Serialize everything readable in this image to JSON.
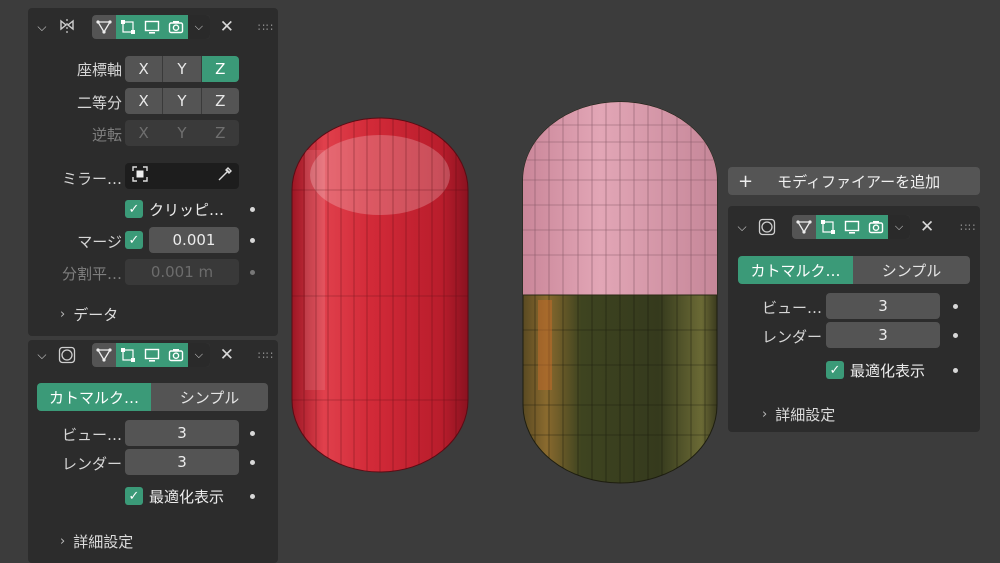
{
  "left_mirror": {
    "axis_label": "座標軸",
    "bisect_label": "二等分",
    "flip_label": "逆転",
    "axes": [
      "X",
      "Y",
      "Z"
    ],
    "mirror_object_label": "ミラー…",
    "clipping_label": "クリッピ…",
    "merge_label": "マージ",
    "merge_value": "0.001",
    "bisect_distance_label": "分割平…",
    "bisect_distance_value": "0.001 m",
    "data_label": "データ"
  },
  "left_subsurf": {
    "tab_catmull": "カトマルク…",
    "tab_simple": "シンプル",
    "viewport_label": "ビュー…",
    "viewport_value": "3",
    "render_label": "レンダー",
    "render_value": "3",
    "optimal_label": "最適化表示",
    "advanced_label": "詳細設定"
  },
  "right_panel": {
    "add_modifier_label": "モディファイアーを追加",
    "tab_catmull": "カトマルク…",
    "tab_simple": "シンプル",
    "viewport_label": "ビュー…",
    "viewport_value": "3",
    "render_label": "レンダー",
    "render_value": "3",
    "optimal_label": "最適化表示",
    "advanced_label": "詳細設定"
  },
  "colors": {
    "accent": "#3b9a78",
    "panel": "#2c2c2c",
    "viewport": "#3c3c3c",
    "red_capsule": "#d2293a",
    "pink_cap": "#d99aad",
    "olive_glass": "#4a4a25"
  },
  "icons": [
    "chevron-down-icon",
    "mirror-modifier-icon",
    "subdivision-modifier-icon",
    "edit-mode-icon",
    "cage-icon",
    "display-viewport-icon",
    "camera-render-icon",
    "dropdown-icon",
    "close-icon",
    "drag-grip-icon",
    "checkbox-checked-icon",
    "eyedropper-icon",
    "plus-icon",
    "chevron-right-icon"
  ]
}
